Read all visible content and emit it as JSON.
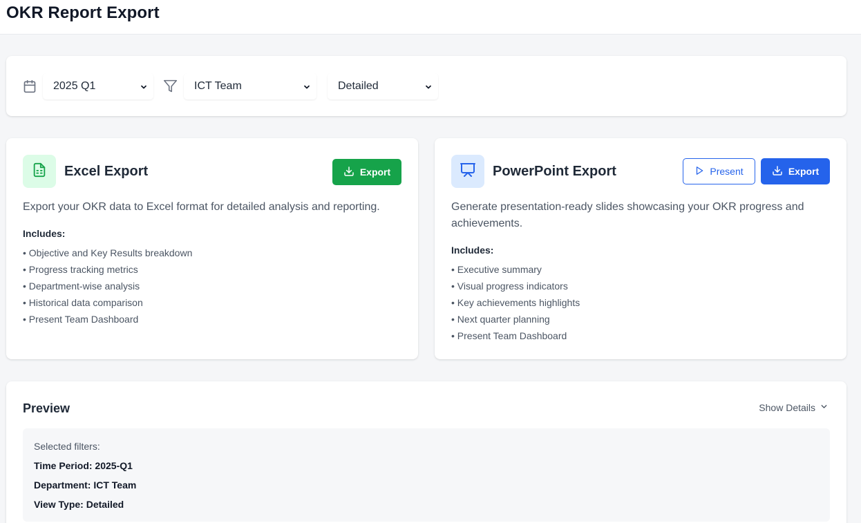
{
  "header": {
    "title": "OKR Report Export"
  },
  "filters": {
    "period": {
      "icon": "calendar-icon",
      "value": "2025 Q1"
    },
    "department": {
      "icon": "filter-icon",
      "value": "ICT Team"
    },
    "view": {
      "value": "Detailed"
    }
  },
  "excel": {
    "icon": "spreadsheet-icon",
    "title": "Excel Export",
    "export_label": "Export",
    "description": "Export your OKR data to Excel format for detailed analysis and reporting.",
    "includes_label": "Includes:",
    "features": [
      "• Objective and Key Results breakdown",
      "• Progress tracking metrics",
      "• Department-wise analysis",
      "• Historical data comparison",
      "• Present Team Dashboard"
    ]
  },
  "ppt": {
    "icon": "presentation-icon",
    "title": "PowerPoint Export",
    "present_label": "Present",
    "export_label": "Export",
    "description": "Generate presentation-ready slides showcasing your OKR progress and achievements.",
    "includes_label": "Includes:",
    "features": [
      "• Executive summary",
      "• Visual progress indicators",
      "• Key achievements highlights",
      "• Next quarter planning",
      "• Present Team Dashboard"
    ]
  },
  "preview": {
    "title": "Preview",
    "show_details": "Show Details",
    "selected_label": "Selected filters:",
    "time_period": "Time Period: 2025-Q1",
    "department": "Department: ICT Team",
    "view_type": "View Type: Detailed"
  },
  "colors": {
    "excel_green": "#16a34a",
    "ppt_blue": "#2563eb",
    "excel_icon_bg": "#dcfce7",
    "ppt_icon_bg": "#dbeafe"
  }
}
